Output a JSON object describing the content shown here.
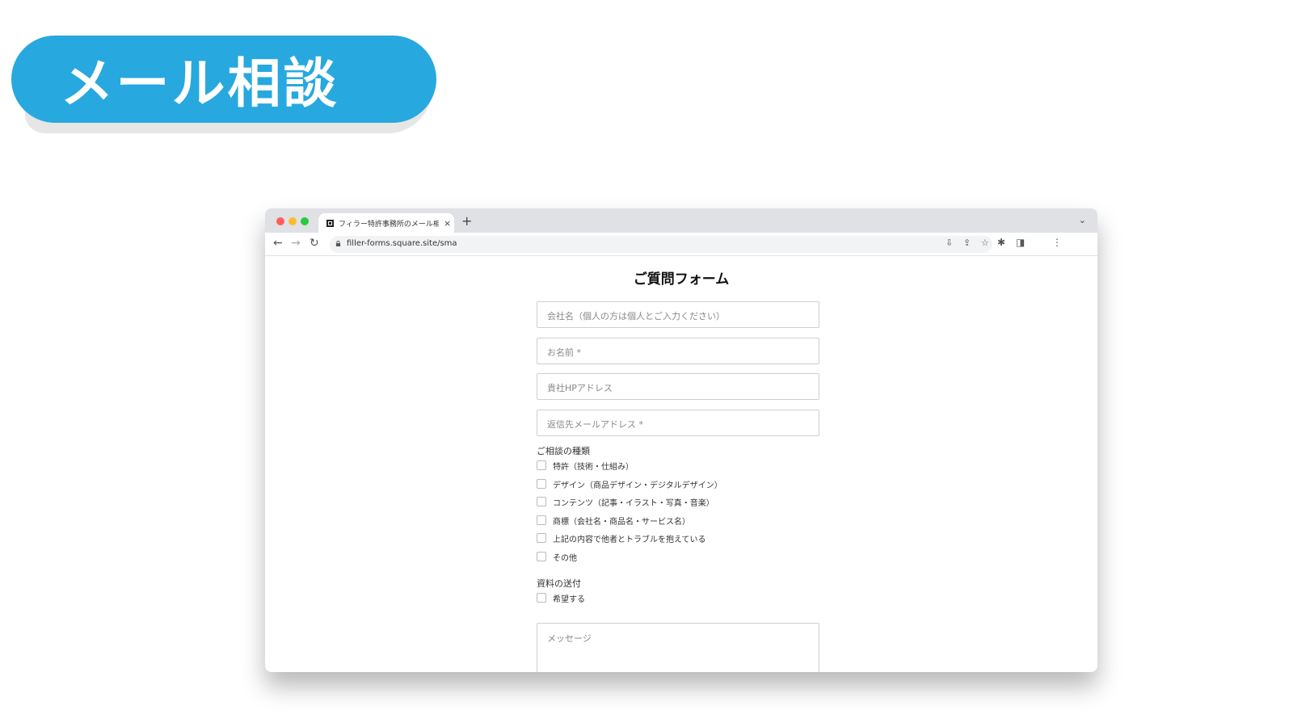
{
  "banner": {
    "title": "メール相談",
    "color": "#27a8df"
  },
  "browser": {
    "tab_title": "フィラー特許事務所のメール相談",
    "tab_close": "×",
    "new_tab": "+",
    "tab_menu": "⌄",
    "url": "filler-forms.square.site/sma",
    "icons": [
      "back-arrow-icon",
      "forward-arrow-icon",
      "reload-icon",
      "lock-icon",
      "install-icon",
      "share-icon",
      "bookmark-star-icon",
      "extensions-icon",
      "side-panel-icon",
      "menu-icon"
    ]
  },
  "form": {
    "title": "ご質問フォーム",
    "fields": {
      "company": "会社名（個人の方は個人とご入力ください）",
      "name": "お名前 *",
      "website": "貴社HPアドレス",
      "email": "返信先メールアドレス *"
    },
    "consultation_label": "ご相談の種類",
    "consultation_options": [
      "特許（技術・仕組み）",
      "デザイン（商品デザイン・デジタルデザイン）",
      "コンテンツ（記事・イラスト・写真・音楽）",
      "商標（会社名・商品名・サービス名）",
      "上記の内容で他者とトラブルを抱えている",
      "その他"
    ],
    "materials_label": "資料の送付",
    "materials_option": "希望する",
    "message_placeholder": "メッセージ"
  }
}
